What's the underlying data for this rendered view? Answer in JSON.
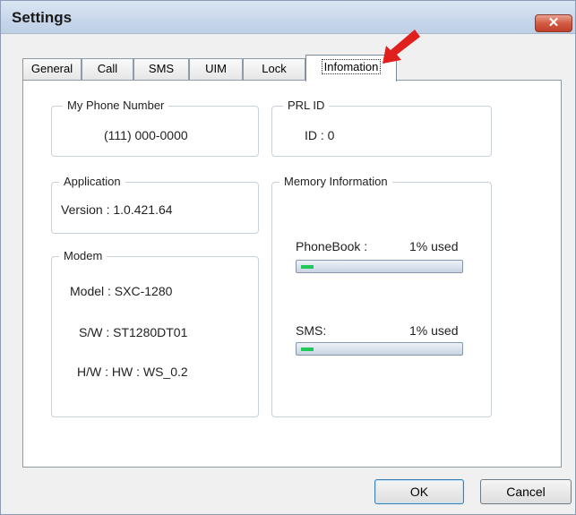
{
  "window": {
    "title": "Settings",
    "close_symbol": "✕"
  },
  "tabs": [
    {
      "label": "General",
      "active": false
    },
    {
      "label": "Call",
      "active": false
    },
    {
      "label": "SMS",
      "active": false
    },
    {
      "label": "UIM",
      "active": false
    },
    {
      "label": "Lock",
      "active": false
    },
    {
      "label": "Infomation",
      "active": true
    }
  ],
  "groups": {
    "phone": {
      "title": "My Phone Number",
      "value": "(111) 000-0000"
    },
    "prl": {
      "title": "PRL ID",
      "value": "ID : 0"
    },
    "application": {
      "title": "Application",
      "version": "Version : 1.0.421.64"
    },
    "modem": {
      "title": "Modem",
      "model": "Model : SXC-1280",
      "sw": "S/W : ST1280DT01",
      "hw": "H/W : HW : WS_0.2"
    },
    "memory": {
      "title": "Memory Information",
      "phonebook": {
        "label": "PhoneBook :",
        "usage": "1% used",
        "percent": 1
      },
      "sms": {
        "label": "SMS:",
        "usage": "1% used",
        "percent": 1
      }
    }
  },
  "buttons": {
    "ok": "OK",
    "cancel": "Cancel"
  },
  "colors": {
    "accent_arrow": "#e0201c",
    "progress_fill": "#1ec95a"
  }
}
